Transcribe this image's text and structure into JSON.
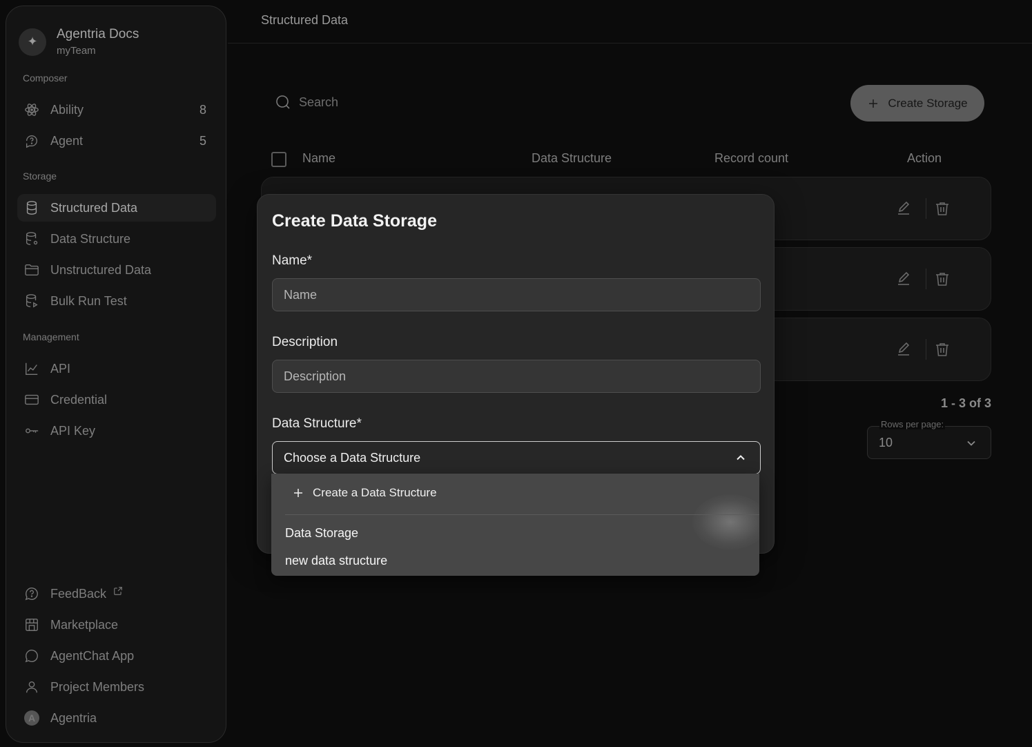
{
  "app": {
    "name": "Agentria Docs",
    "team": "myTeam",
    "logo_icon": "sparkle-icon"
  },
  "sidebar": {
    "composer_label": "Composer",
    "composer_items": [
      {
        "label": "Ability",
        "count": "8",
        "icon": "atom-icon"
      },
      {
        "label": "Agent",
        "count": "5",
        "icon": "agent-icon"
      }
    ],
    "storage_label": "Storage",
    "storage_items": [
      {
        "label": "Structured Data",
        "icon": "database-icon",
        "active": true
      },
      {
        "label": "Data Structure",
        "icon": "database-settings-icon"
      },
      {
        "label": "Unstructured Data",
        "icon": "folder-icon"
      },
      {
        "label": "Bulk Run Test",
        "icon": "database-run-icon"
      }
    ],
    "management_label": "Management",
    "management_items": [
      {
        "label": "API",
        "icon": "chart-line-icon"
      },
      {
        "label": "Credential",
        "icon": "credit-card-icon"
      },
      {
        "label": "API Key",
        "icon": "key-icon"
      }
    ],
    "bottom_items": [
      {
        "label": "FeedBack",
        "icon": "help-circle-icon",
        "external": true
      },
      {
        "label": "Marketplace",
        "icon": "store-icon"
      },
      {
        "label": "AgentChat App",
        "icon": "chat-bubble-icon"
      },
      {
        "label": "Project Members",
        "icon": "user-icon"
      },
      {
        "label": "Agentria",
        "avatar_letter": "A"
      }
    ]
  },
  "header": {
    "title": "Structured Data"
  },
  "toolbar": {
    "search_placeholder": "Search",
    "create_button_label": "Create Storage"
  },
  "table": {
    "columns": [
      "Name",
      "Data Structure",
      "Record count",
      "Action"
    ],
    "rows": [
      {},
      {},
      {}
    ]
  },
  "pagination": {
    "summary": "1 - 3 of 3",
    "rows_per_page_label": "Rows per page:",
    "rows_per_page_value": "10"
  },
  "modal": {
    "title": "Create Data Storage",
    "name_label": "Name*",
    "name_placeholder": "Name",
    "description_label": "Description",
    "description_placeholder": "Description",
    "data_structure_label": "Data Structure*",
    "data_structure_placeholder": "Choose a Data Structure",
    "dropdown": {
      "create_label": "Create a Data Structure",
      "options": [
        "Data Storage",
        "new data structure"
      ]
    }
  },
  "colors": {
    "background": "#0b0b0b",
    "sidebar": "#141414",
    "modal": "#262626",
    "dropdown": "#474747",
    "primary_button": "#5a5a5a"
  }
}
